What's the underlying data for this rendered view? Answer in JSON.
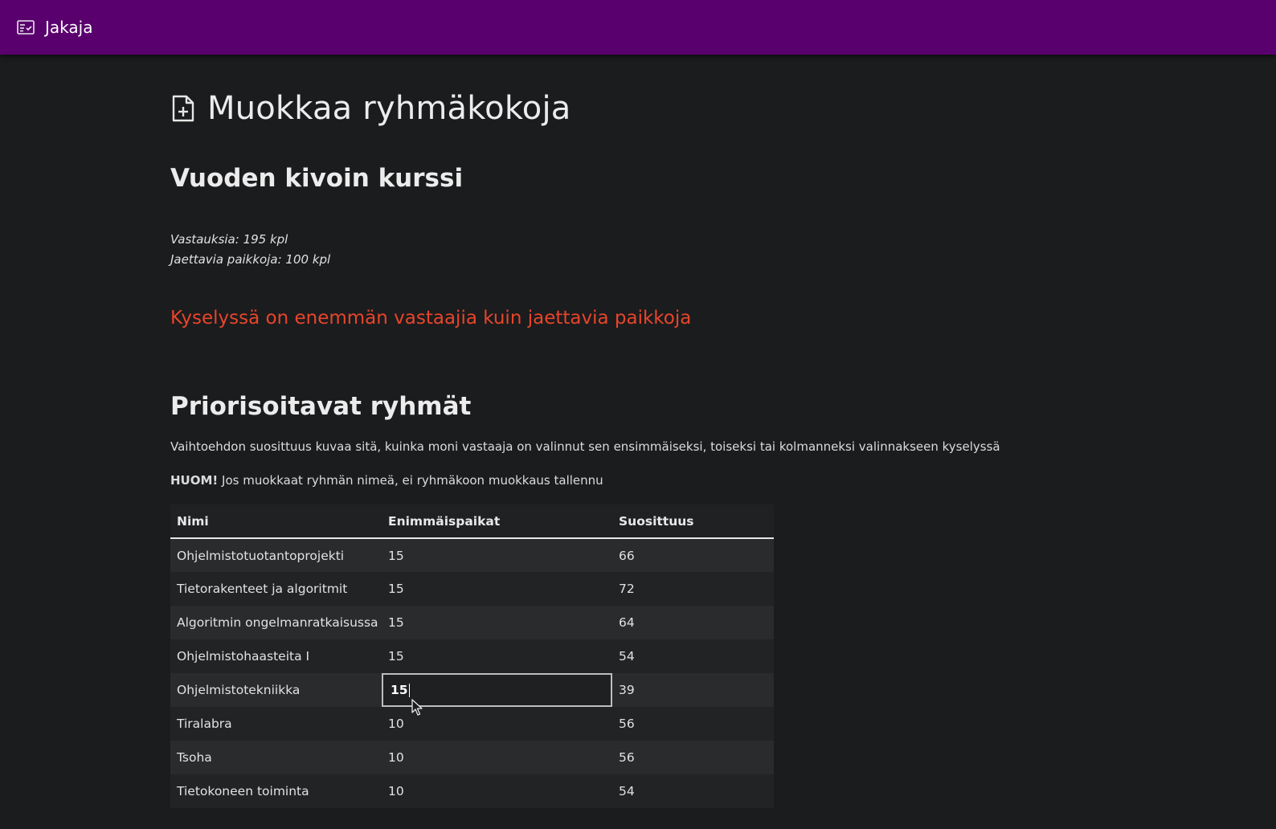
{
  "appbar": {
    "title": "Jakaja",
    "icon": "list-check-icon",
    "color": "#5a006e"
  },
  "page": {
    "title": "Muokkaa ryhmäkokoja",
    "title_icon": "file-plus-icon",
    "course_name": "Vuoden kivoin kurssi",
    "answers": "Vastauksia: 195 kpl",
    "seats": "Jaettavia paikkoja: 100 kpl",
    "warning": "Kyselyssä on enemmän vastaajia kuin jaettavia paikkoja",
    "warning_color": "#e8452a"
  },
  "groups_section": {
    "title": "Priorisoitavat ryhmät",
    "description": "Vaihtoehdon suosittuus kuvaa sitä, kuinka moni vastaaja on valinnut sen ensimmäiseksi, toiseksi tai kolmanneksi valinnakseen kyselyssä",
    "note_bold": "HUOM!",
    "note_text": " Jos muokkaat ryhmän nimeä, ei ryhmäkoon muokkaus tallennu"
  },
  "table": {
    "headers": [
      "Nimi",
      "Enimmäispaikat",
      "Suosittuus"
    ],
    "rows": [
      {
        "name": "Ohjelmistotuotantoprojekti",
        "max": "15",
        "popularity": "66"
      },
      {
        "name": "Tietorakenteet ja algoritmit",
        "max": "15",
        "popularity": "72"
      },
      {
        "name": "Algoritmin ongelmanratkaisussa",
        "max": "15",
        "popularity": "64"
      },
      {
        "name": "Ohjelmistohaasteita I",
        "max": "15",
        "popularity": "54"
      },
      {
        "name": "Ohjelmistotekniikka",
        "max": "15",
        "popularity": "39"
      },
      {
        "name": "Tiralabra",
        "max": "10",
        "popularity": "56"
      },
      {
        "name": "Tsoha",
        "max": "10",
        "popularity": "56"
      },
      {
        "name": "Tietokoneen toiminta",
        "max": "10",
        "popularity": "54"
      }
    ]
  }
}
